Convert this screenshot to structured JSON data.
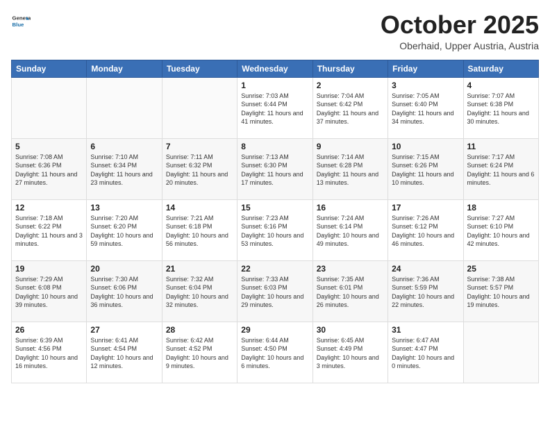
{
  "logo": {
    "general": "General",
    "blue": "Blue"
  },
  "title": "October 2025",
  "location": "Oberhaid, Upper Austria, Austria",
  "weekdays": [
    "Sunday",
    "Monday",
    "Tuesday",
    "Wednesday",
    "Thursday",
    "Friday",
    "Saturday"
  ],
  "weeks": [
    [
      {
        "day": "",
        "sunrise": "",
        "sunset": "",
        "daylight": ""
      },
      {
        "day": "",
        "sunrise": "",
        "sunset": "",
        "daylight": ""
      },
      {
        "day": "",
        "sunrise": "",
        "sunset": "",
        "daylight": ""
      },
      {
        "day": "1",
        "sunrise": "Sunrise: 7:03 AM",
        "sunset": "Sunset: 6:44 PM",
        "daylight": "Daylight: 11 hours and 41 minutes."
      },
      {
        "day": "2",
        "sunrise": "Sunrise: 7:04 AM",
        "sunset": "Sunset: 6:42 PM",
        "daylight": "Daylight: 11 hours and 37 minutes."
      },
      {
        "day": "3",
        "sunrise": "Sunrise: 7:05 AM",
        "sunset": "Sunset: 6:40 PM",
        "daylight": "Daylight: 11 hours and 34 minutes."
      },
      {
        "day": "4",
        "sunrise": "Sunrise: 7:07 AM",
        "sunset": "Sunset: 6:38 PM",
        "daylight": "Daylight: 11 hours and 30 minutes."
      }
    ],
    [
      {
        "day": "5",
        "sunrise": "Sunrise: 7:08 AM",
        "sunset": "Sunset: 6:36 PM",
        "daylight": "Daylight: 11 hours and 27 minutes."
      },
      {
        "day": "6",
        "sunrise": "Sunrise: 7:10 AM",
        "sunset": "Sunset: 6:34 PM",
        "daylight": "Daylight: 11 hours and 23 minutes."
      },
      {
        "day": "7",
        "sunrise": "Sunrise: 7:11 AM",
        "sunset": "Sunset: 6:32 PM",
        "daylight": "Daylight: 11 hours and 20 minutes."
      },
      {
        "day": "8",
        "sunrise": "Sunrise: 7:13 AM",
        "sunset": "Sunset: 6:30 PM",
        "daylight": "Daylight: 11 hours and 17 minutes."
      },
      {
        "day": "9",
        "sunrise": "Sunrise: 7:14 AM",
        "sunset": "Sunset: 6:28 PM",
        "daylight": "Daylight: 11 hours and 13 minutes."
      },
      {
        "day": "10",
        "sunrise": "Sunrise: 7:15 AM",
        "sunset": "Sunset: 6:26 PM",
        "daylight": "Daylight: 11 hours and 10 minutes."
      },
      {
        "day": "11",
        "sunrise": "Sunrise: 7:17 AM",
        "sunset": "Sunset: 6:24 PM",
        "daylight": "Daylight: 11 hours and 6 minutes."
      }
    ],
    [
      {
        "day": "12",
        "sunrise": "Sunrise: 7:18 AM",
        "sunset": "Sunset: 6:22 PM",
        "daylight": "Daylight: 11 hours and 3 minutes."
      },
      {
        "day": "13",
        "sunrise": "Sunrise: 7:20 AM",
        "sunset": "Sunset: 6:20 PM",
        "daylight": "Daylight: 10 hours and 59 minutes."
      },
      {
        "day": "14",
        "sunrise": "Sunrise: 7:21 AM",
        "sunset": "Sunset: 6:18 PM",
        "daylight": "Daylight: 10 hours and 56 minutes."
      },
      {
        "day": "15",
        "sunrise": "Sunrise: 7:23 AM",
        "sunset": "Sunset: 6:16 PM",
        "daylight": "Daylight: 10 hours and 53 minutes."
      },
      {
        "day": "16",
        "sunrise": "Sunrise: 7:24 AM",
        "sunset": "Sunset: 6:14 PM",
        "daylight": "Daylight: 10 hours and 49 minutes."
      },
      {
        "day": "17",
        "sunrise": "Sunrise: 7:26 AM",
        "sunset": "Sunset: 6:12 PM",
        "daylight": "Daylight: 10 hours and 46 minutes."
      },
      {
        "day": "18",
        "sunrise": "Sunrise: 7:27 AM",
        "sunset": "Sunset: 6:10 PM",
        "daylight": "Daylight: 10 hours and 42 minutes."
      }
    ],
    [
      {
        "day": "19",
        "sunrise": "Sunrise: 7:29 AM",
        "sunset": "Sunset: 6:08 PM",
        "daylight": "Daylight: 10 hours and 39 minutes."
      },
      {
        "day": "20",
        "sunrise": "Sunrise: 7:30 AM",
        "sunset": "Sunset: 6:06 PM",
        "daylight": "Daylight: 10 hours and 36 minutes."
      },
      {
        "day": "21",
        "sunrise": "Sunrise: 7:32 AM",
        "sunset": "Sunset: 6:04 PM",
        "daylight": "Daylight: 10 hours and 32 minutes."
      },
      {
        "day": "22",
        "sunrise": "Sunrise: 7:33 AM",
        "sunset": "Sunset: 6:03 PM",
        "daylight": "Daylight: 10 hours and 29 minutes."
      },
      {
        "day": "23",
        "sunrise": "Sunrise: 7:35 AM",
        "sunset": "Sunset: 6:01 PM",
        "daylight": "Daylight: 10 hours and 26 minutes."
      },
      {
        "day": "24",
        "sunrise": "Sunrise: 7:36 AM",
        "sunset": "Sunset: 5:59 PM",
        "daylight": "Daylight: 10 hours and 22 minutes."
      },
      {
        "day": "25",
        "sunrise": "Sunrise: 7:38 AM",
        "sunset": "Sunset: 5:57 PM",
        "daylight": "Daylight: 10 hours and 19 minutes."
      }
    ],
    [
      {
        "day": "26",
        "sunrise": "Sunrise: 6:39 AM",
        "sunset": "Sunset: 4:56 PM",
        "daylight": "Daylight: 10 hours and 16 minutes."
      },
      {
        "day": "27",
        "sunrise": "Sunrise: 6:41 AM",
        "sunset": "Sunset: 4:54 PM",
        "daylight": "Daylight: 10 hours and 12 minutes."
      },
      {
        "day": "28",
        "sunrise": "Sunrise: 6:42 AM",
        "sunset": "Sunset: 4:52 PM",
        "daylight": "Daylight: 10 hours and 9 minutes."
      },
      {
        "day": "29",
        "sunrise": "Sunrise: 6:44 AM",
        "sunset": "Sunset: 4:50 PM",
        "daylight": "Daylight: 10 hours and 6 minutes."
      },
      {
        "day": "30",
        "sunrise": "Sunrise: 6:45 AM",
        "sunset": "Sunset: 4:49 PM",
        "daylight": "Daylight: 10 hours and 3 minutes."
      },
      {
        "day": "31",
        "sunrise": "Sunrise: 6:47 AM",
        "sunset": "Sunset: 4:47 PM",
        "daylight": "Daylight: 10 hours and 0 minutes."
      },
      {
        "day": "",
        "sunrise": "",
        "sunset": "",
        "daylight": ""
      }
    ]
  ]
}
